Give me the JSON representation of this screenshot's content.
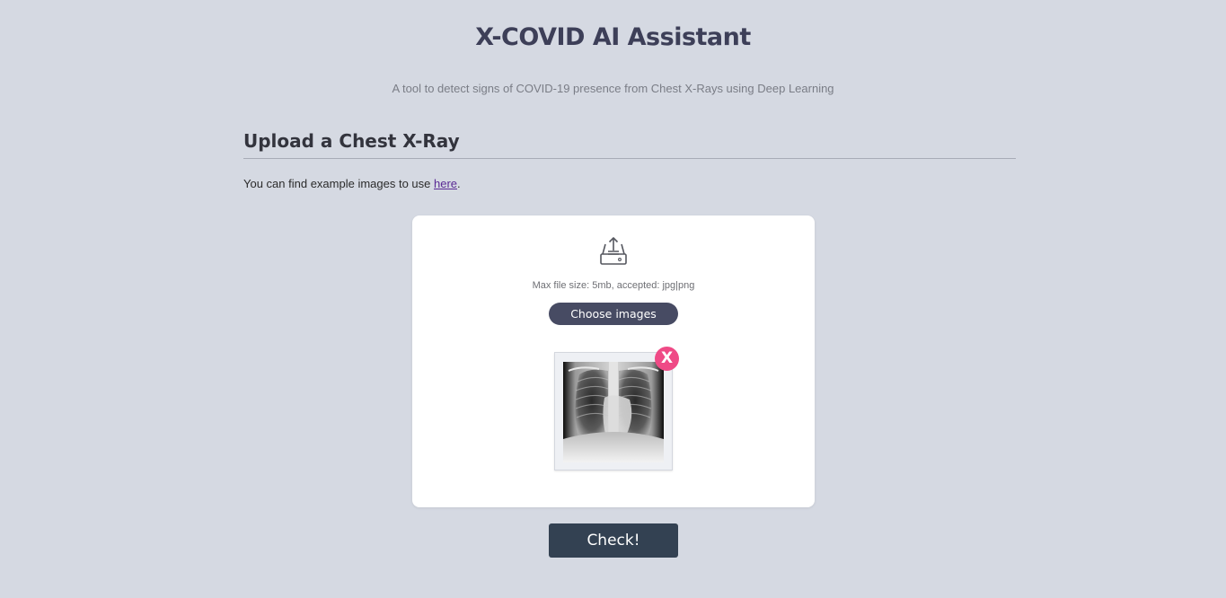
{
  "header": {
    "title": "X-COVID AI Assistant",
    "subtitle": "A tool to detect signs of COVID-19 presence from Chest X-Rays using Deep Learning"
  },
  "upload_section": {
    "heading": "Upload a Chest X-Ray",
    "example_prefix": "You can find example images to use ",
    "example_link": "here",
    "example_suffix": "."
  },
  "upload_card": {
    "icon": "upload-tray-icon",
    "file_hint": "Max file size: 5mb, accepted: jpg|png",
    "choose_label": "Choose images",
    "preview": {
      "image_kind": "chest-xray",
      "remove_label": "X",
      "remove_color": "#ef4a86"
    }
  },
  "actions": {
    "check_label": "Check!"
  },
  "colors": {
    "background": "#d5d9e2",
    "title": "#3d3f58",
    "choose_button": "#474b63",
    "check_button": "#334152",
    "link": "#5a2a94"
  }
}
